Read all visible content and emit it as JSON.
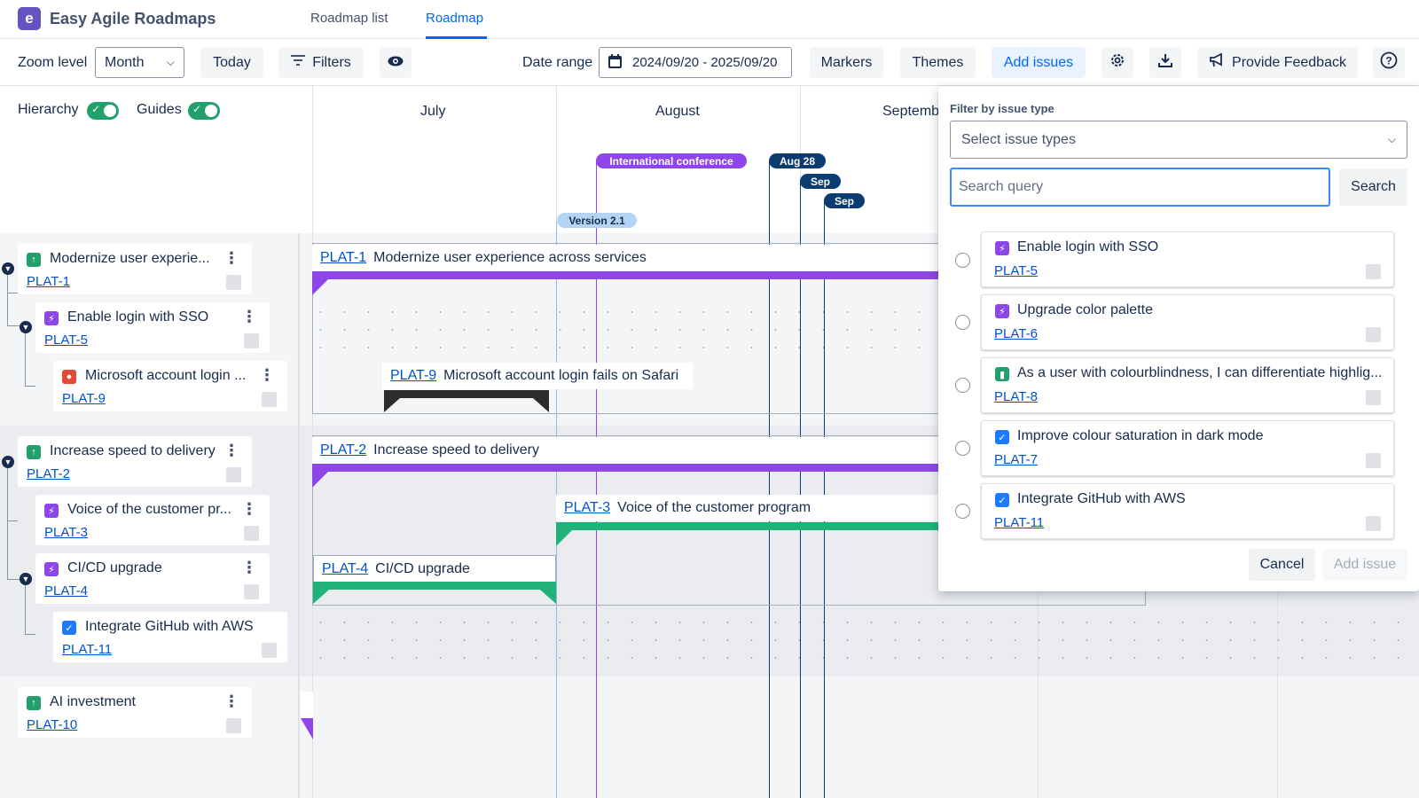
{
  "header": {
    "app_title": "Easy Agile Roadmaps",
    "logo_letter": "e",
    "tabs": [
      {
        "label": "Roadmap list"
      },
      {
        "label": "Roadmap"
      }
    ]
  },
  "toolbar": {
    "zoom_label": "Zoom level",
    "zoom_value": "Month",
    "today": "Today",
    "filters": "Filters",
    "date_range_label": "Date range",
    "date_range_value": "2024/09/20 - 2025/09/20",
    "markers": "Markers",
    "themes": "Themes",
    "add_issues": "Add issues",
    "provide_feedback": "Provide Feedback"
  },
  "panel_toggles": {
    "hierarchy": "Hierarchy",
    "guides": "Guides"
  },
  "months": [
    "July",
    "August",
    "Septemb"
  ],
  "markers": [
    {
      "label": "International conference",
      "color": "#8f46e8"
    },
    {
      "label": "Aug 28",
      "color": "#0c3c6f"
    },
    {
      "label": "Sep",
      "color": "#0c3c6f"
    },
    {
      "label": "Sep",
      "color": "#0c3c6f"
    },
    {
      "label": "Version 2.1",
      "color": "#bbdefb"
    }
  ],
  "issues": [
    {
      "title": "Modernize user experie...",
      "key": "PLAT-1",
      "type": "epic"
    },
    {
      "title": "Enable login with SSO",
      "key": "PLAT-5",
      "type": "story"
    },
    {
      "title": "Microsoft account login ...",
      "key": "PLAT-9",
      "type": "bug"
    },
    {
      "title": "Increase speed to delivery",
      "key": "PLAT-2",
      "type": "epic"
    },
    {
      "title": "Voice of the customer pr...",
      "key": "PLAT-3",
      "type": "story"
    },
    {
      "title": "CI/CD upgrade",
      "key": "PLAT-4",
      "type": "story"
    },
    {
      "title": "Integrate GitHub with AWS",
      "key": "PLAT-11",
      "type": "task"
    },
    {
      "title": "AI investment",
      "key": "PLAT-10",
      "type": "epic"
    }
  ],
  "bars": [
    {
      "key": "PLAT-1",
      "title": "Modernize user experience across services",
      "color": "#8f46e8"
    },
    {
      "key": "PLAT-9",
      "title": "Microsoft account login fails on Safari",
      "color": "#2c2c2c"
    },
    {
      "key": "PLAT-2",
      "title": "Increase speed to delivery",
      "color": "#8f46e8"
    },
    {
      "key": "PLAT-3",
      "title": "Voice of the customer program",
      "color": "#1fb37a"
    },
    {
      "key": "PLAT-4",
      "title": "CI/CD upgrade",
      "color": "#1fb37a"
    }
  ],
  "add_panel": {
    "filter_label": "Filter by issue type",
    "select_placeholder": "Select issue types",
    "search_placeholder": "Search query",
    "search_button": "Search",
    "results": [
      {
        "title": "Enable login with SSO",
        "key": "PLAT-5",
        "type": "story"
      },
      {
        "title": "Upgrade color palette",
        "key": "PLAT-6",
        "type": "story"
      },
      {
        "title": "As a user with colourblindness, I can differentiate highlig...",
        "key": "PLAT-8",
        "type": "user-story"
      },
      {
        "title": "Improve colour saturation in dark mode",
        "key": "PLAT-7",
        "type": "task"
      },
      {
        "title": "Integrate GitHub with AWS",
        "key": "PLAT-11",
        "type": "task"
      }
    ],
    "cancel": "Cancel",
    "add_issue": "Add issue"
  }
}
